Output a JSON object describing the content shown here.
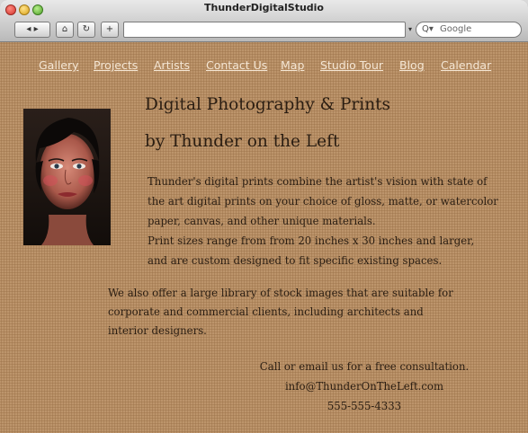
{
  "window": {
    "title": "ThunderDigitalStudio"
  },
  "toolbar": {
    "back_forward": "◂ ▸",
    "home": "⌂",
    "reload": "↻",
    "add": "+",
    "url": "",
    "search_placeholder": "Google",
    "search_icon": "Q▾"
  },
  "nav": {
    "items": [
      {
        "label": "Gallery"
      },
      {
        "label": "Projects"
      },
      {
        "label": "Artists"
      },
      {
        "label": "Contact Us"
      },
      {
        "label": "Map"
      },
      {
        "label": "Studio Tour"
      },
      {
        "label": "Blog"
      },
      {
        "label": "Calendar"
      }
    ]
  },
  "main": {
    "heading_line1": "Digital Photography & Prints",
    "heading_line2": "by Thunder on the Left",
    "intro_lines": [
      "Thunder's digital prints combine the artist's vision with state of",
      "the art digital prints on your choice of gloss, matte, or watercolor",
      "paper, canvas, and other unique materials.",
      "Print sizes range from from 20 inches x 30 inches and larger,",
      "and are custom designed to fit specific existing spaces."
    ],
    "stock_lines": [
      "We also offer a large library of stock images that are suitable for",
      "corporate and commercial clients, including architects and",
      "interior designers."
    ],
    "contact": {
      "cta": "Call or email us for a free consultation.",
      "email": "info@ThunderOnTheLeft.com",
      "phone": "555-555-4333"
    }
  },
  "colors": {
    "page_background": "#b88e63",
    "nav_link": "#f4e6d4",
    "body_text": "#2a1d12"
  }
}
